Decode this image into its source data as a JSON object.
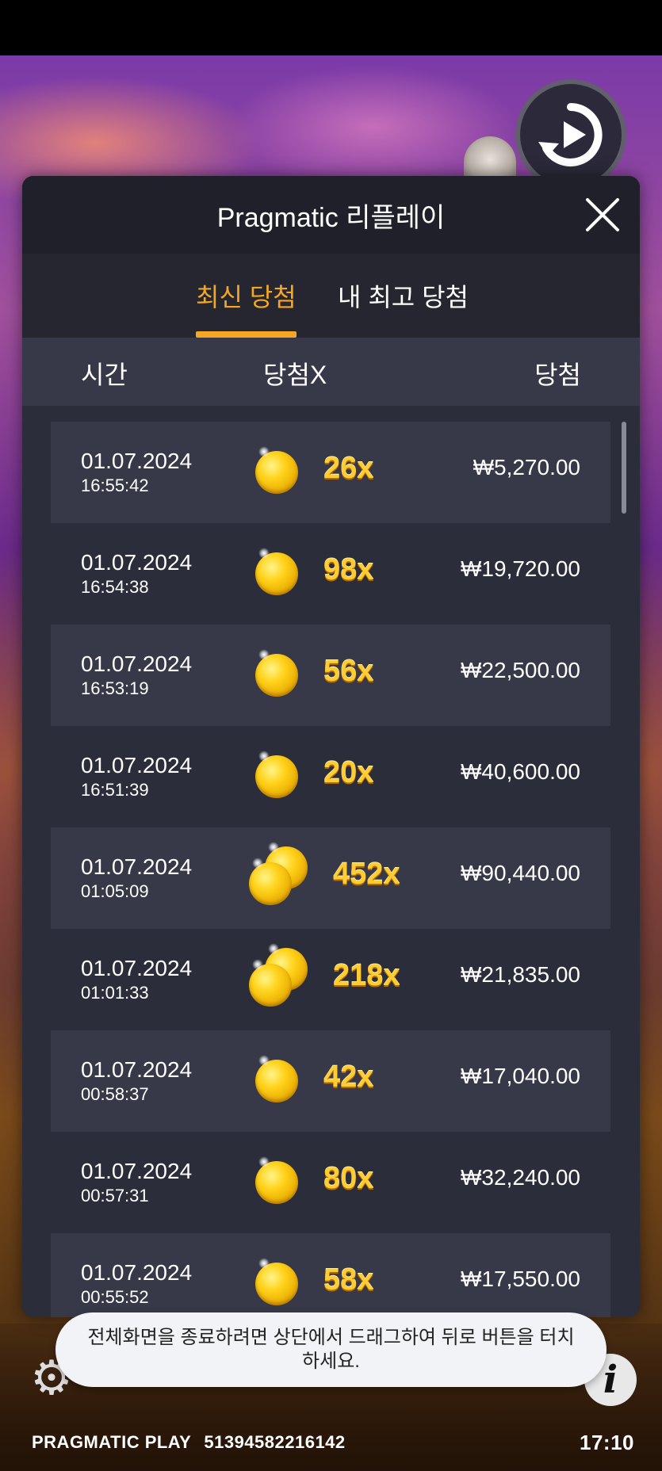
{
  "modal": {
    "title": "Pragmatic 리플레이",
    "tabs": [
      {
        "label": "최신 당첨",
        "active": true
      },
      {
        "label": "내 최고 당첨",
        "active": false
      }
    ],
    "columns": {
      "time": "시간",
      "multiplier": "당첨X",
      "win": "당첨"
    },
    "rows": [
      {
        "date": "01.07.2024",
        "time": "16:55:42",
        "multiplier": "26x",
        "coins": 1,
        "amount": "₩5,270.00"
      },
      {
        "date": "01.07.2024",
        "time": "16:54:38",
        "multiplier": "98x",
        "coins": 1,
        "amount": "₩19,720.00"
      },
      {
        "date": "01.07.2024",
        "time": "16:53:19",
        "multiplier": "56x",
        "coins": 1,
        "amount": "₩22,500.00"
      },
      {
        "date": "01.07.2024",
        "time": "16:51:39",
        "multiplier": "20x",
        "coins": 1,
        "amount": "₩40,600.00"
      },
      {
        "date": "01.07.2024",
        "time": "01:05:09",
        "multiplier": "452x",
        "coins": 2,
        "amount": "₩90,440.00"
      },
      {
        "date": "01.07.2024",
        "time": "01:01:33",
        "multiplier": "218x",
        "coins": 2,
        "amount": "₩21,835.00"
      },
      {
        "date": "01.07.2024",
        "time": "00:58:37",
        "multiplier": "42x",
        "coins": 1,
        "amount": "₩17,040.00"
      },
      {
        "date": "01.07.2024",
        "time": "00:57:31",
        "multiplier": "80x",
        "coins": 1,
        "amount": "₩32,240.00"
      },
      {
        "date": "01.07.2024",
        "time": "00:55:52",
        "multiplier": "58x",
        "coins": 1,
        "amount": "₩17,550.00"
      }
    ]
  },
  "toast": {
    "text": "전체화면을 종료하려면 상단에서 드래그하여 뒤로 버튼을 터치하세요."
  },
  "footer": {
    "brand": "PRAGMATIC PLAY",
    "session_id": "51394582216142",
    "clock": "17:10"
  },
  "icons": {
    "replay": "replay-icon",
    "close": "close-icon",
    "settings": "gear-icon",
    "info": "info-icon",
    "coin": "coin-icon"
  },
  "colors": {
    "accent": "#f5a623",
    "modal_bg": "#2c2d3b",
    "row_shade": "#373848",
    "multiplier": "#ffcc33"
  }
}
